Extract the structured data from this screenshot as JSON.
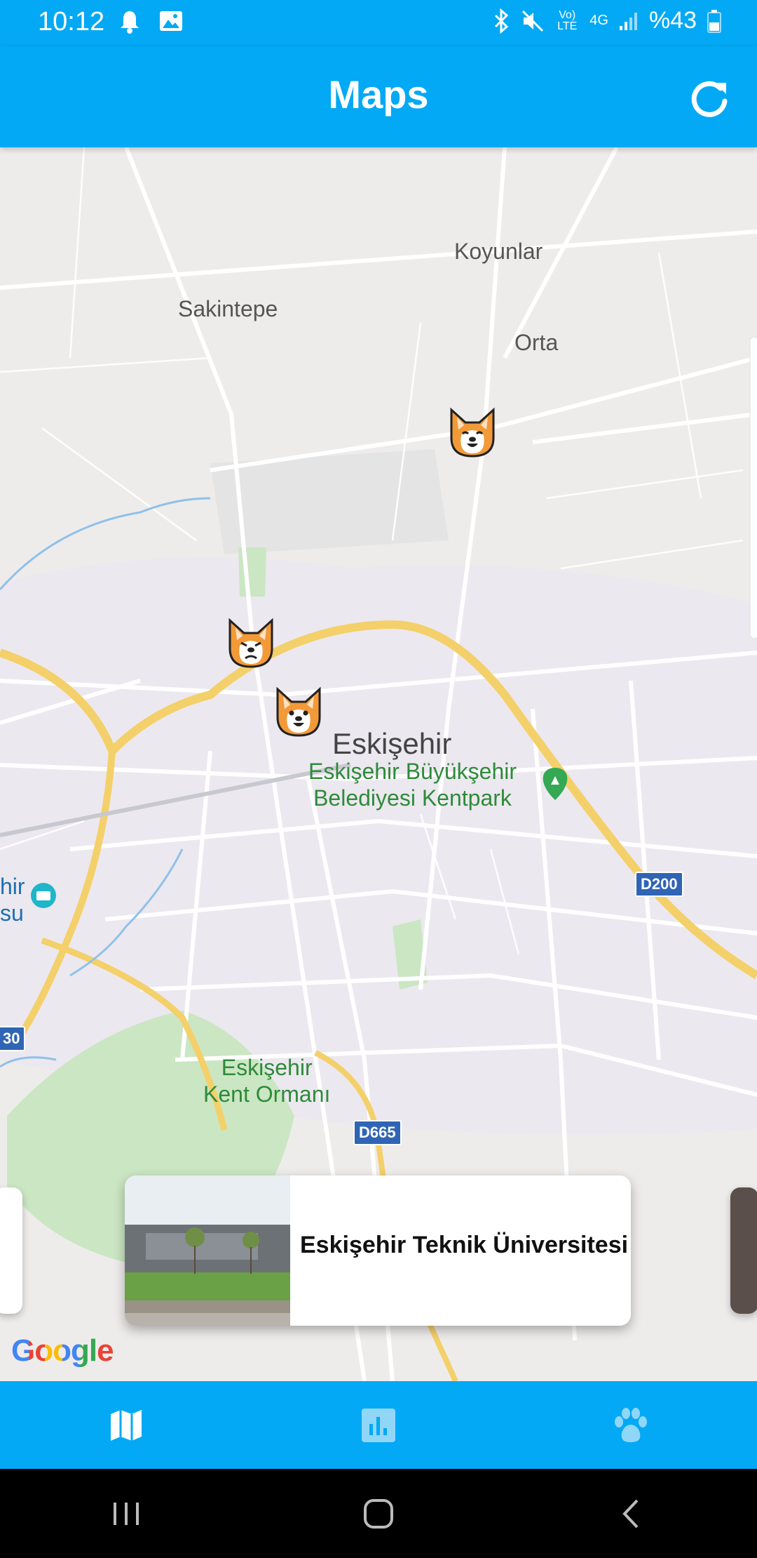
{
  "status_bar": {
    "time": "10:12",
    "battery": "%43",
    "network": "4G",
    "volte": "Vo) LTE"
  },
  "app_bar": {
    "title": "Maps"
  },
  "map": {
    "places": {
      "koyunlar": "Koyunlar",
      "sakintepe": "Sakintepe",
      "orta": "Orta",
      "eskisehir": "Eskişehir",
      "kentpark_line1": "Eskişehir Büyükşehir",
      "kentpark_line2": "Belediyesi Kentpark",
      "kent_ormani_line1": "Eskişehir",
      "kent_ormani_line2": "Kent Ormanı",
      "edge_left_line1": "hir",
      "edge_left_line2": "su"
    },
    "road_badges": {
      "d200": "D200",
      "d665": "D665",
      "edge": "30"
    },
    "markers": [
      "dog-marker",
      "dog-marker",
      "dog-marker"
    ],
    "attribution": "Google"
  },
  "place_card": {
    "title": "Eskişehir Teknik Üniversitesi"
  },
  "bottom_nav": {
    "items": [
      {
        "icon": "map-icon",
        "active": true
      },
      {
        "icon": "chart-icon",
        "active": false
      },
      {
        "icon": "paw-icon",
        "active": false
      }
    ]
  },
  "colors": {
    "primary": "#03a9f4",
    "map_background": "#eeeceb",
    "highway": "#f7d66b",
    "park_green": "#c9e6c0"
  }
}
